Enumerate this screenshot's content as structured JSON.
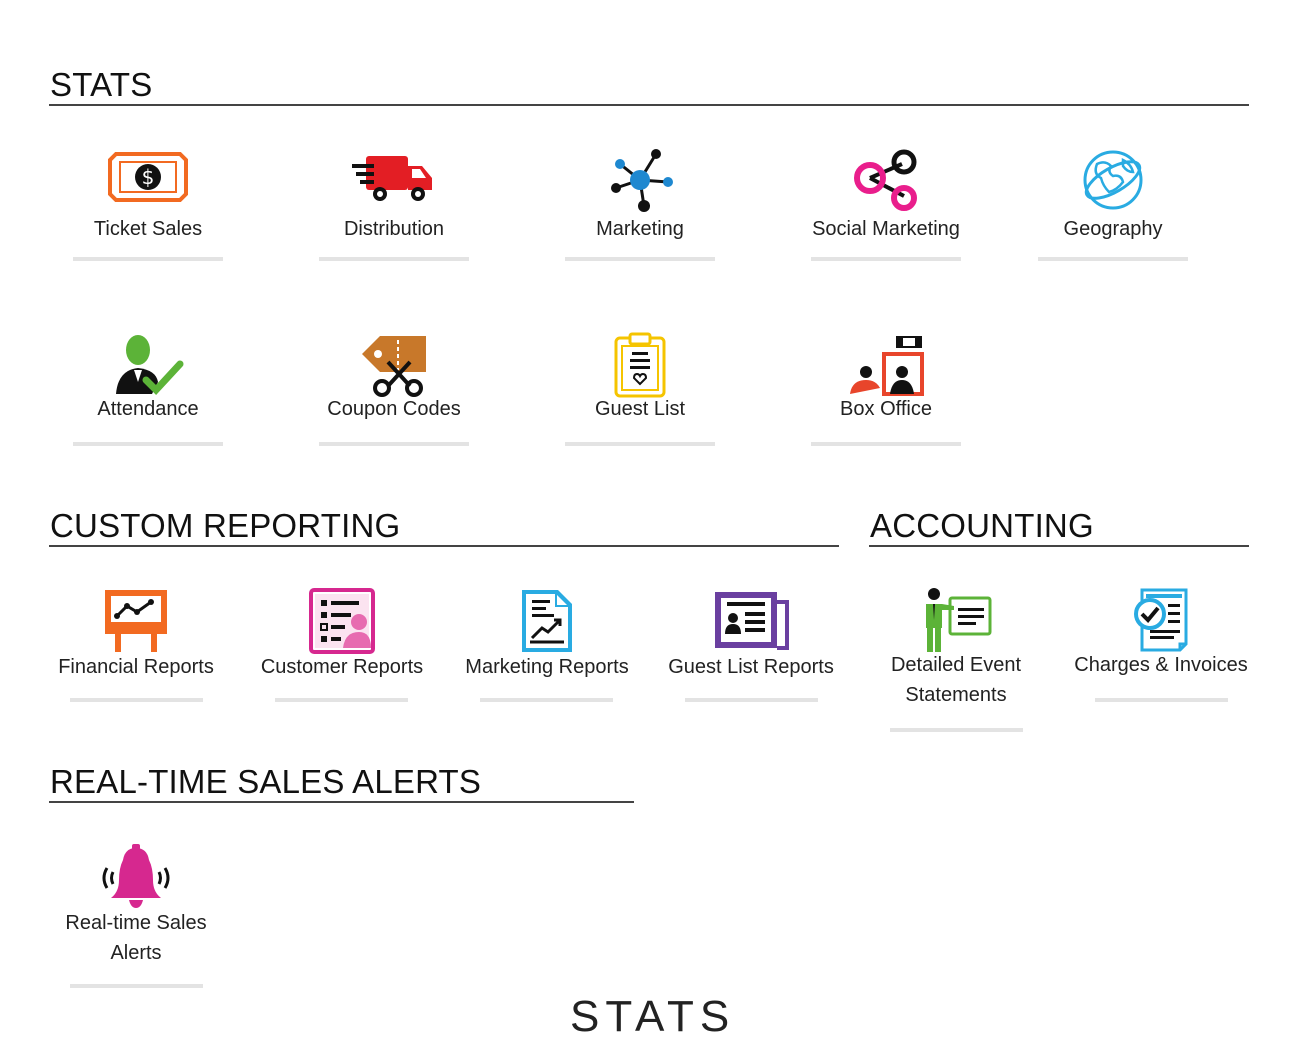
{
  "sections": {
    "stats": {
      "title": "STATS"
    },
    "custom_reporting": {
      "title": "CUSTOM REPORTING"
    },
    "accounting": {
      "title": "ACCOUNTING"
    },
    "alerts": {
      "title": "REAL-TIME SALES ALERTS"
    }
  },
  "stats_tiles": [
    {
      "label": "Ticket Sales",
      "icon": "dollar-bill-icon"
    },
    {
      "label": "Distribution",
      "icon": "delivery-truck-icon"
    },
    {
      "label": "Marketing",
      "icon": "network-nodes-icon"
    },
    {
      "label": "Social Marketing",
      "icon": "share-circles-icon"
    },
    {
      "label": "Geography",
      "icon": "globe-icon"
    },
    {
      "label": "Attendance",
      "icon": "person-check-icon"
    },
    {
      "label": "Coupon Codes",
      "icon": "coupon-scissors-icon"
    },
    {
      "label": "Guest List",
      "icon": "clipboard-icon"
    },
    {
      "label": "Box Office",
      "icon": "box-office-icon"
    }
  ],
  "custom_reporting_tiles": [
    {
      "label": "Financial Reports",
      "icon": "easel-chart-icon"
    },
    {
      "label": "Customer Reports",
      "icon": "customer-list-icon"
    },
    {
      "label": "Marketing Reports",
      "icon": "document-chart-icon"
    },
    {
      "label": "Guest List Reports",
      "icon": "newspaper-icon"
    }
  ],
  "accounting_tiles": [
    {
      "label_line1": "Detailed Event",
      "label_line2": "Statements",
      "icon": "presenter-board-icon"
    },
    {
      "label": "Charges & Invoices",
      "icon": "invoice-check-icon"
    }
  ],
  "alert_tiles": [
    {
      "label_line1": "Real-time Sales",
      "label_line2": "Alerts",
      "icon": "ringing-bell-icon"
    }
  ],
  "footer": {
    "partial_heading": "STATS"
  },
  "colors": {
    "orange": "#f26a21",
    "red": "#e31e24",
    "blue": "#1e88d0",
    "pink": "#e91e8c",
    "cyan": "#29abe2",
    "green": "#5cb338",
    "brown": "#c8782a",
    "yellow": "#f5c400",
    "magenta": "#d6288f",
    "purple": "#6a3fa0"
  }
}
